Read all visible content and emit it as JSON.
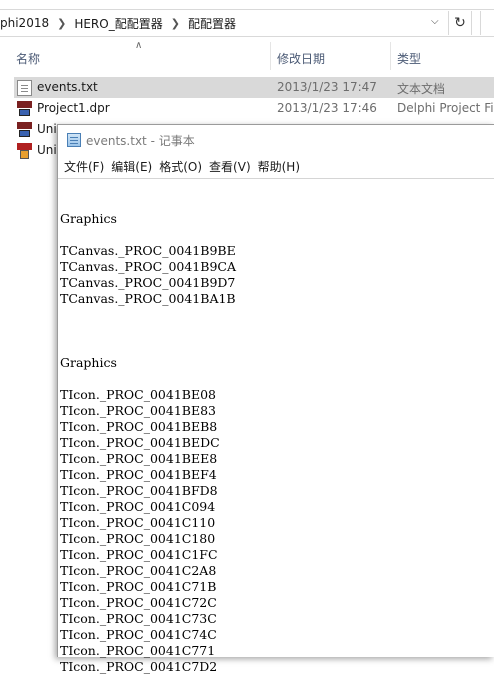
{
  "explorer": {
    "breadcrumb": [
      "phi2018",
      "HERO_配配置器",
      "配配置器"
    ],
    "columns": {
      "name": "名称",
      "date": "修改日期",
      "type": "类型"
    },
    "files": [
      {
        "name": "events.txt",
        "date": "2013/1/23 17:47",
        "type": "文本文档",
        "icon": "text-file-icon"
      },
      {
        "name": "Project1.dpr",
        "date": "2013/1/23 17:46",
        "type": "Delphi Project File",
        "icon": "delphi-project-icon"
      },
      {
        "name": "Uni",
        "date": "",
        "type": "",
        "icon": "delphi-form-icon"
      },
      {
        "name": "Uni",
        "date": "",
        "type": "",
        "icon": "delphi-pascal-icon"
      }
    ]
  },
  "notepad": {
    "title": "events.txt - 记事本",
    "menu": [
      "文件(F)",
      "编辑(E)",
      "格式(O)",
      "查看(V)",
      "帮助(H)"
    ],
    "lines": [
      "",
      "Graphics",
      "",
      "TCanvas._PROC_0041B9BE",
      "TCanvas._PROC_0041B9CA",
      "TCanvas._PROC_0041B9D7",
      "TCanvas._PROC_0041BA1B",
      "",
      "",
      "",
      "Graphics",
      "",
      "TIcon._PROC_0041BE08",
      "TIcon._PROC_0041BE83",
      "TIcon._PROC_0041BEB8",
      "TIcon._PROC_0041BEDC",
      "TIcon._PROC_0041BEE8",
      "TIcon._PROC_0041BEF4",
      "TIcon._PROC_0041BFD8",
      "TIcon._PROC_0041C094",
      "TIcon._PROC_0041C110",
      "TIcon._PROC_0041C180",
      "TIcon._PROC_0041C1FC",
      "TIcon._PROC_0041C2A8",
      "TIcon._PROC_0041C71B",
      "TIcon._PROC_0041C72C",
      "TIcon._PROC_0041C73C",
      "TIcon._PROC_0041C74C",
      "TIcon._PROC_0041C771",
      "TIcon._PROC_0041C7D2"
    ]
  }
}
